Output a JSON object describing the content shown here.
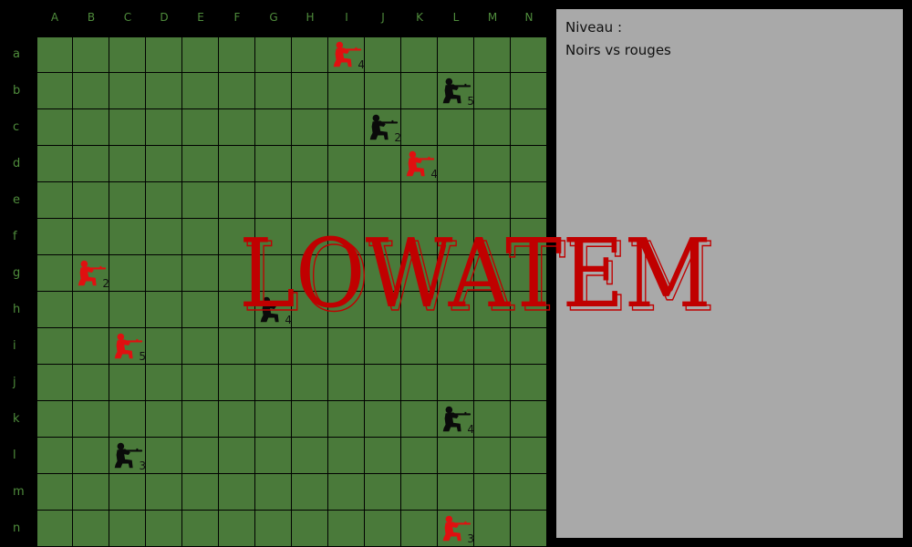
{
  "columns": [
    "A",
    "B",
    "C",
    "D",
    "E",
    "F",
    "G",
    "H",
    "I",
    "J",
    "K",
    "L",
    "M",
    "N"
  ],
  "rows": [
    "a",
    "b",
    "c",
    "d",
    "e",
    "f",
    "g",
    "h",
    "i",
    "j",
    "k",
    "l",
    "m",
    "n"
  ],
  "colors": {
    "board": "#4a7a3a",
    "grid": "#000000",
    "label": "#4f8c3c",
    "red_team": "#e01010",
    "black_team": "#0a0a0a",
    "panel": "#a9a9a9",
    "logo": "#c00000"
  },
  "units": [
    {
      "team": "red",
      "col": "I",
      "row": "a",
      "count": "4"
    },
    {
      "team": "black",
      "col": "L",
      "row": "b",
      "count": "5"
    },
    {
      "team": "black",
      "col": "J",
      "row": "c",
      "count": "2"
    },
    {
      "team": "red",
      "col": "K",
      "row": "d",
      "count": "4"
    },
    {
      "team": "red",
      "col": "B",
      "row": "g",
      "count": "2"
    },
    {
      "team": "black",
      "col": "G",
      "row": "h",
      "count": "4"
    },
    {
      "team": "red",
      "col": "C",
      "row": "i",
      "count": "5"
    },
    {
      "team": "black",
      "col": "L",
      "row": "k",
      "count": "4"
    },
    {
      "team": "black",
      "col": "C",
      "row": "l",
      "count": "3"
    },
    {
      "team": "red",
      "col": "L",
      "row": "n",
      "count": "3"
    }
  ],
  "panel": {
    "level_label": "Niveau :",
    "mode_text": "Noirs vs rouges"
  },
  "logo_text": "LOWATEM",
  "icons": {
    "unit": "kneeling-soldier-icon"
  }
}
